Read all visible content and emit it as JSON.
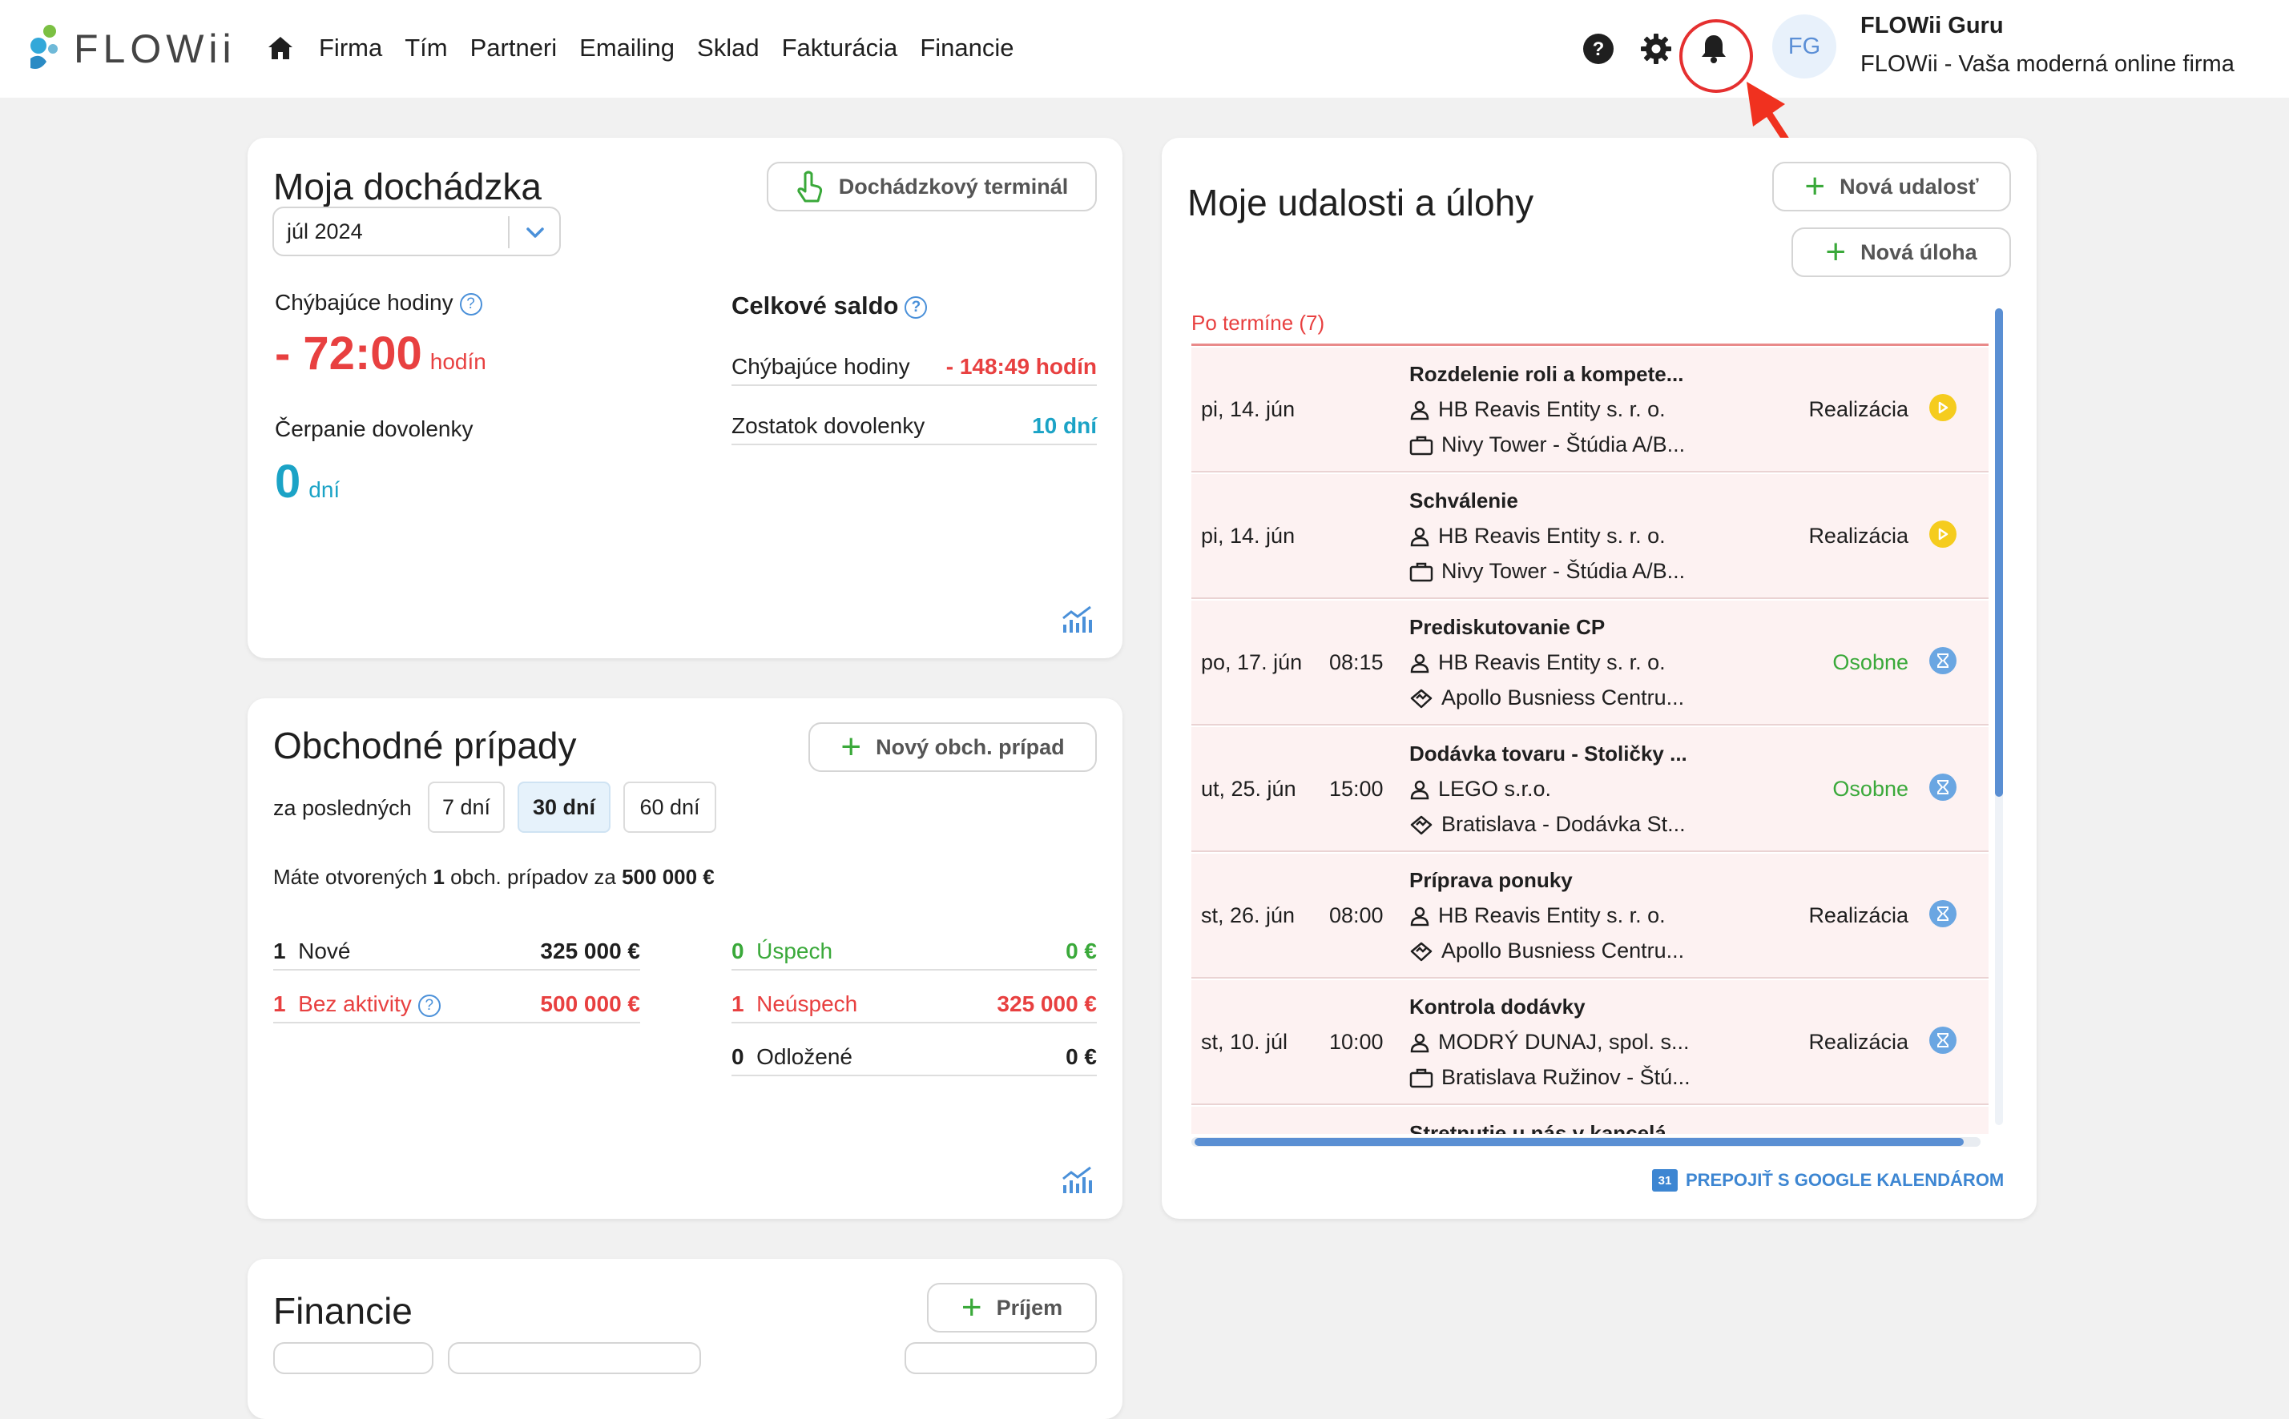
{
  "brand": {
    "name": "FLOWii"
  },
  "nav": {
    "items": [
      "Firma",
      "Tím",
      "Partneri",
      "Emailing",
      "Sklad",
      "Fakturácia",
      "Financie"
    ]
  },
  "user": {
    "initials": "FG",
    "name": "FLOWii Guru",
    "company": "FLOWii - Vaša moderná online firma"
  },
  "icons": {
    "home": "home-icon",
    "help": "help-icon",
    "settings": "gear-icon",
    "notifications": "bell-icon"
  },
  "colors": {
    "accent": "#3aa93a",
    "danger": "#e84040",
    "teal": "#1ba3c6",
    "link": "#3d86d2"
  },
  "attendance": {
    "title": "Moja dochádzka",
    "terminal_button": "Dochádzkový terminál",
    "month": "júl 2024",
    "missing_hours_label": "Chýbajúce hodiny",
    "missing_hours_value": "- 72:00",
    "missing_hours_unit": "hodín",
    "vacation_label": "Čerpanie dovolenky",
    "vacation_value": "0",
    "vacation_unit": "dní",
    "balance_title": "Celkové saldo",
    "balance_rows": [
      {
        "label": "Chýbajúce hodiny",
        "value": "- 148:49 hodín"
      },
      {
        "label": "Zostatok dovolenky",
        "value": "10 dní"
      }
    ]
  },
  "deals": {
    "title": "Obchodné prípady",
    "new_button": "Nový obch. prípad",
    "period_label": "za posledných",
    "periods": [
      "7 dní",
      "30 dní",
      "60 dní"
    ],
    "active_period": "30 dní",
    "summary_prefix": "Máte otvorených",
    "summary_count": "1",
    "summary_middle": "obch. prípadov za",
    "summary_amount": "500 000 €",
    "left_rows": [
      {
        "count": "1",
        "label": "Nové",
        "value": "325 000 €"
      },
      {
        "count": "1",
        "label": "Bez aktivity",
        "value": "500 000 €"
      }
    ],
    "right_rows": [
      {
        "count": "0",
        "label": "Úspech",
        "value": "0 €"
      },
      {
        "count": "1",
        "label": "Neúspech",
        "value": "325 000 €"
      },
      {
        "count": "0",
        "label": "Odložené",
        "value": "0 €"
      }
    ]
  },
  "finance": {
    "title": "Financie",
    "income_button": "Príjem"
  },
  "events": {
    "title": "Moje udalosti a úlohy",
    "new_event_button": "Nová udalosť",
    "new_task_button": "Nová úloha",
    "overdue_label": "Po termíne (7)",
    "items": [
      {
        "date": "pi, 14. jún",
        "time": "",
        "title": "Rozdelenie roli a kompete...",
        "partner": "HB Reavis Entity s. r. o.",
        "place": "Nivy Tower - Štúdia A/B...",
        "place_icon": "briefcase-icon",
        "status": "Realizácia",
        "status_icon": "play-icon"
      },
      {
        "date": "pi, 14. jún",
        "time": "",
        "title": "Schválenie",
        "partner": "HB Reavis Entity s. r. o.",
        "place": "Nivy Tower - Štúdia A/B...",
        "place_icon": "briefcase-icon",
        "status": "Realizácia",
        "status_icon": "play-icon"
      },
      {
        "date": "po, 17. jún",
        "time": "08:15",
        "title": "Prediskutovanie CP",
        "partner": "HB Reavis Entity s. r. o.",
        "place": "Apollo Busniess Centru...",
        "place_icon": "handshake-icon",
        "status": "Osobne",
        "status_icon": "hourglass-icon"
      },
      {
        "date": "ut, 25. jún",
        "time": "15:00",
        "title": "Dodávka tovaru - Stoličky ...",
        "partner": "LEGO s.r.o.",
        "place": "Bratislava - Dodávka St...",
        "place_icon": "handshake-icon",
        "status": "Osobne",
        "status_icon": "hourglass-icon"
      },
      {
        "date": "st, 26. jún",
        "time": "08:00",
        "title": "Príprava ponuky",
        "partner": "HB Reavis Entity s. r. o.",
        "place": "Apollo Busniess Centru...",
        "place_icon": "handshake-icon",
        "status": "Realizácia",
        "status_icon": "hourglass-icon"
      },
      {
        "date": "st, 10. júl",
        "time": "10:00",
        "title": "Kontrola dodávky",
        "partner": "MODRÝ DUNAJ, spol. s...",
        "place": "Bratislava Ružinov - Štú...",
        "place_icon": "briefcase-icon",
        "status": "Realizácia",
        "status_icon": "hourglass-icon"
      },
      {
        "date": "",
        "time": "",
        "title": "Stretnutie u nás v kancelá...",
        "partner": "",
        "place": "",
        "place_icon": "",
        "status": "",
        "status_icon": ""
      }
    ],
    "google_link": "PREPOJIŤ S GOOGLE KALENDÁROM",
    "google_icon_text": "31"
  }
}
